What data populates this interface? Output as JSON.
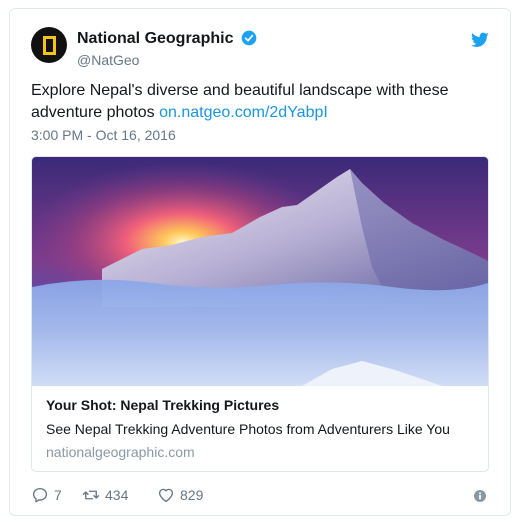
{
  "author": {
    "name": "National Geographic",
    "handle": "@NatGeo"
  },
  "tweet": {
    "text": "Explore Nepal's diverse and beautiful landscape with these adventure photos ",
    "link_text": "on.natgeo.com/2dYabpI",
    "timestamp": "3:00 PM - Oct 16, 2016"
  },
  "card": {
    "title": "Your Shot: Nepal Trekking Pictures",
    "description": "See Nepal Trekking Adventure Photos from Adventurers Like You",
    "domain": "nationalgeographic.com"
  },
  "actions": {
    "replies": "7",
    "retweets": "434",
    "likes": "829"
  },
  "colors": {
    "link": "#1b95e0",
    "verified": "#1da1f2",
    "brand_yellow": "#f7c416"
  }
}
